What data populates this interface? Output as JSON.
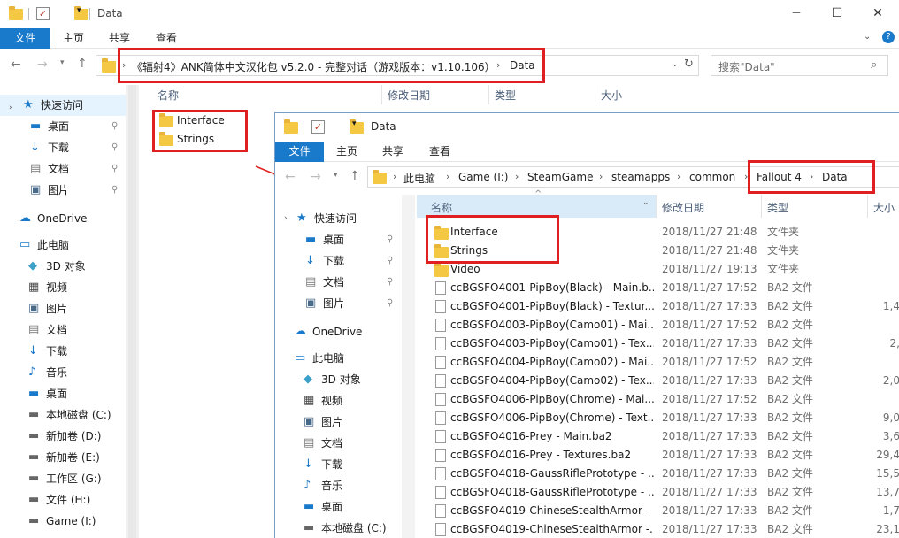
{
  "back_window": {
    "title": "Data",
    "ribbon_tabs": [
      "文件",
      "主页",
      "共享",
      "查看"
    ],
    "address": {
      "path_text": "《辐射4》ANK简体中文汉化包 v5.2.0 - 完整对话（游戏版本：v1.10.106）",
      "current": "Data"
    },
    "search_placeholder": "搜索\"Data\"",
    "columns": [
      "名称",
      "修改日期",
      "类型",
      "大小"
    ],
    "files": [
      "Interface",
      "Strings"
    ],
    "sidebar": {
      "quick_access": "快速访问",
      "quick_items": [
        "桌面",
        "下载",
        "文档",
        "图片"
      ],
      "onedrive": "OneDrive",
      "this_pc": "此电脑",
      "pc_items": [
        "3D 对象",
        "视频",
        "图片",
        "文档",
        "下载",
        "音乐",
        "桌面"
      ],
      "drives": [
        "本地磁盘 (C:)",
        "新加卷 (D:)",
        "新加卷 (E:)",
        "工作区 (G:)",
        "文件 (H:)",
        "Game (I:)"
      ]
    }
  },
  "front_window": {
    "title": "Data",
    "ribbon_tabs": [
      "文件",
      "主页",
      "共享",
      "查看"
    ],
    "breadcrumbs": [
      "此电脑",
      "Game (I:)",
      "SteamGame",
      "steamapps",
      "common",
      "Fallout 4",
      "Data"
    ],
    "columns": [
      "名称",
      "修改日期",
      "类型",
      "大小"
    ],
    "sidebar": {
      "quick_access": "快速访问",
      "quick_items": [
        "桌面",
        "下载",
        "文档",
        "图片"
      ],
      "onedrive": "OneDrive",
      "this_pc": "此电脑",
      "pc_items": [
        "3D 对象",
        "视频",
        "图片",
        "文档",
        "下载",
        "音乐",
        "桌面"
      ],
      "drives": [
        "本地磁盘 (C:)"
      ]
    },
    "rows": [
      {
        "name": "Interface",
        "date": "2018/11/27 21:48",
        "type": "文件夹",
        "size": "",
        "kind": "folder"
      },
      {
        "name": "Strings",
        "date": "2018/11/27 21:48",
        "type": "文件夹",
        "size": "",
        "kind": "folder"
      },
      {
        "name": "Video",
        "date": "2018/11/27 19:13",
        "type": "文件夹",
        "size": "",
        "kind": "folder"
      },
      {
        "name": "ccBGSFO4001-PipBoy(Black) - Main.b...",
        "date": "2018/11/27 17:52",
        "type": "BA2 文件",
        "size": "",
        "kind": "file"
      },
      {
        "name": "ccBGSFO4001-PipBoy(Black) - Textur...",
        "date": "2018/11/27 17:33",
        "type": "BA2 文件",
        "size": "1,4",
        "kind": "file"
      },
      {
        "name": "ccBGSFO4003-PipBoy(Camo01) - Mai...",
        "date": "2018/11/27 17:52",
        "type": "BA2 文件",
        "size": "",
        "kind": "file"
      },
      {
        "name": "ccBGSFO4003-PipBoy(Camo01) - Tex...",
        "date": "2018/11/27 17:33",
        "type": "BA2 文件",
        "size": "2,",
        "kind": "file"
      },
      {
        "name": "ccBGSFO4004-PipBoy(Camo02) - Mai...",
        "date": "2018/11/27 17:52",
        "type": "BA2 文件",
        "size": "",
        "kind": "file"
      },
      {
        "name": "ccBGSFO4004-PipBoy(Camo02) - Tex...",
        "date": "2018/11/27 17:33",
        "type": "BA2 文件",
        "size": "2,0",
        "kind": "file"
      },
      {
        "name": "ccBGSFO4006-PipBoy(Chrome) - Mai...",
        "date": "2018/11/27 17:52",
        "type": "BA2 文件",
        "size": "",
        "kind": "file"
      },
      {
        "name": "ccBGSFO4006-PipBoy(Chrome) - Text...",
        "date": "2018/11/27 17:33",
        "type": "BA2 文件",
        "size": "9,0",
        "kind": "file"
      },
      {
        "name": "ccBGSFO4016-Prey - Main.ba2",
        "date": "2018/11/27 17:33",
        "type": "BA2 文件",
        "size": "3,6",
        "kind": "file"
      },
      {
        "name": "ccBGSFO4016-Prey - Textures.ba2",
        "date": "2018/11/27 17:33",
        "type": "BA2 文件",
        "size": "29,4",
        "kind": "file"
      },
      {
        "name": "ccBGSFO4018-GaussRiflePrototype - ...",
        "date": "2018/11/27 17:33",
        "type": "BA2 文件",
        "size": "15,5",
        "kind": "file"
      },
      {
        "name": "ccBGSFO4018-GaussRiflePrototype - ...",
        "date": "2018/11/27 17:33",
        "type": "BA2 文件",
        "size": "13,7",
        "kind": "file"
      },
      {
        "name": "ccBGSFO4019-ChineseStealthArmor - ...",
        "date": "2018/11/27 17:33",
        "type": "BA2 文件",
        "size": "1,7",
        "kind": "file"
      },
      {
        "name": "ccBGSFO4019-ChineseStealthArmor -...",
        "date": "2018/11/27 17:33",
        "type": "BA2 文件",
        "size": "23,1",
        "kind": "file"
      }
    ]
  },
  "colors": {
    "accent": "#1979ca",
    "highlight": "#e02020",
    "selection": "#cce8ff",
    "folder": "#f5c843"
  }
}
